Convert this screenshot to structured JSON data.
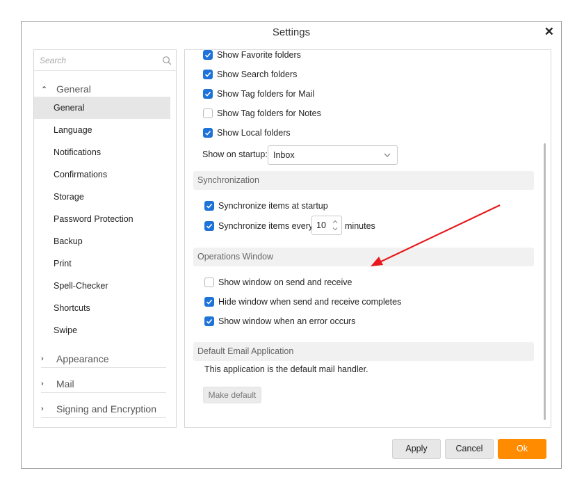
{
  "window": {
    "title": "Settings"
  },
  "sidebar": {
    "search_placeholder": "Search",
    "groups": [
      {
        "label": "General",
        "expanded": true
      },
      {
        "label": "Appearance",
        "expanded": false
      },
      {
        "label": "Mail",
        "expanded": false
      },
      {
        "label": "Signing and Encryption",
        "expanded": false
      }
    ],
    "items": [
      {
        "label": "General",
        "selected": true
      },
      {
        "label": "Language"
      },
      {
        "label": "Notifications"
      },
      {
        "label": "Confirmations"
      },
      {
        "label": "Storage"
      },
      {
        "label": "Password Protection"
      },
      {
        "label": "Backup"
      },
      {
        "label": "Print"
      },
      {
        "label": "Spell-Checker"
      },
      {
        "label": "Shortcuts"
      },
      {
        "label": "Swipe"
      }
    ]
  },
  "folders": {
    "options": [
      {
        "label": "Show Favorite folders",
        "checked": true
      },
      {
        "label": "Show Search folders",
        "checked": true
      },
      {
        "label": "Show Tag folders for Mail",
        "checked": true
      },
      {
        "label": "Show Tag folders for Notes",
        "checked": false
      },
      {
        "label": "Show Local folders",
        "checked": true
      }
    ],
    "startup_label": "Show on startup:",
    "startup_value": "Inbox"
  },
  "sync": {
    "header": "Synchronization",
    "at_startup": {
      "label": "Synchronize items at startup",
      "checked": true
    },
    "every": {
      "label": "Synchronize items every",
      "checked": true,
      "value": "10",
      "unit": "minutes"
    }
  },
  "ops": {
    "header": "Operations Window",
    "options": [
      {
        "label": "Show window on send and receive",
        "checked": false
      },
      {
        "label": "Hide window when send and receive completes",
        "checked": true
      },
      {
        "label": "Show window when an error occurs",
        "checked": true
      }
    ]
  },
  "email_app": {
    "header": "Default Email Application",
    "text": "This application is the default mail handler.",
    "button": "Make default"
  },
  "footer": {
    "apply": "Apply",
    "cancel": "Cancel",
    "ok": "Ok"
  },
  "colors": {
    "accent": "#ff8c00",
    "checkbox": "#1e73d8",
    "annotation_arrow": "#e8191c"
  },
  "icons": [
    "close-icon",
    "search-icon",
    "chevron-up-icon",
    "chevron-right-icon",
    "chevron-down-icon",
    "check-icon",
    "arrow-annotation"
  ]
}
